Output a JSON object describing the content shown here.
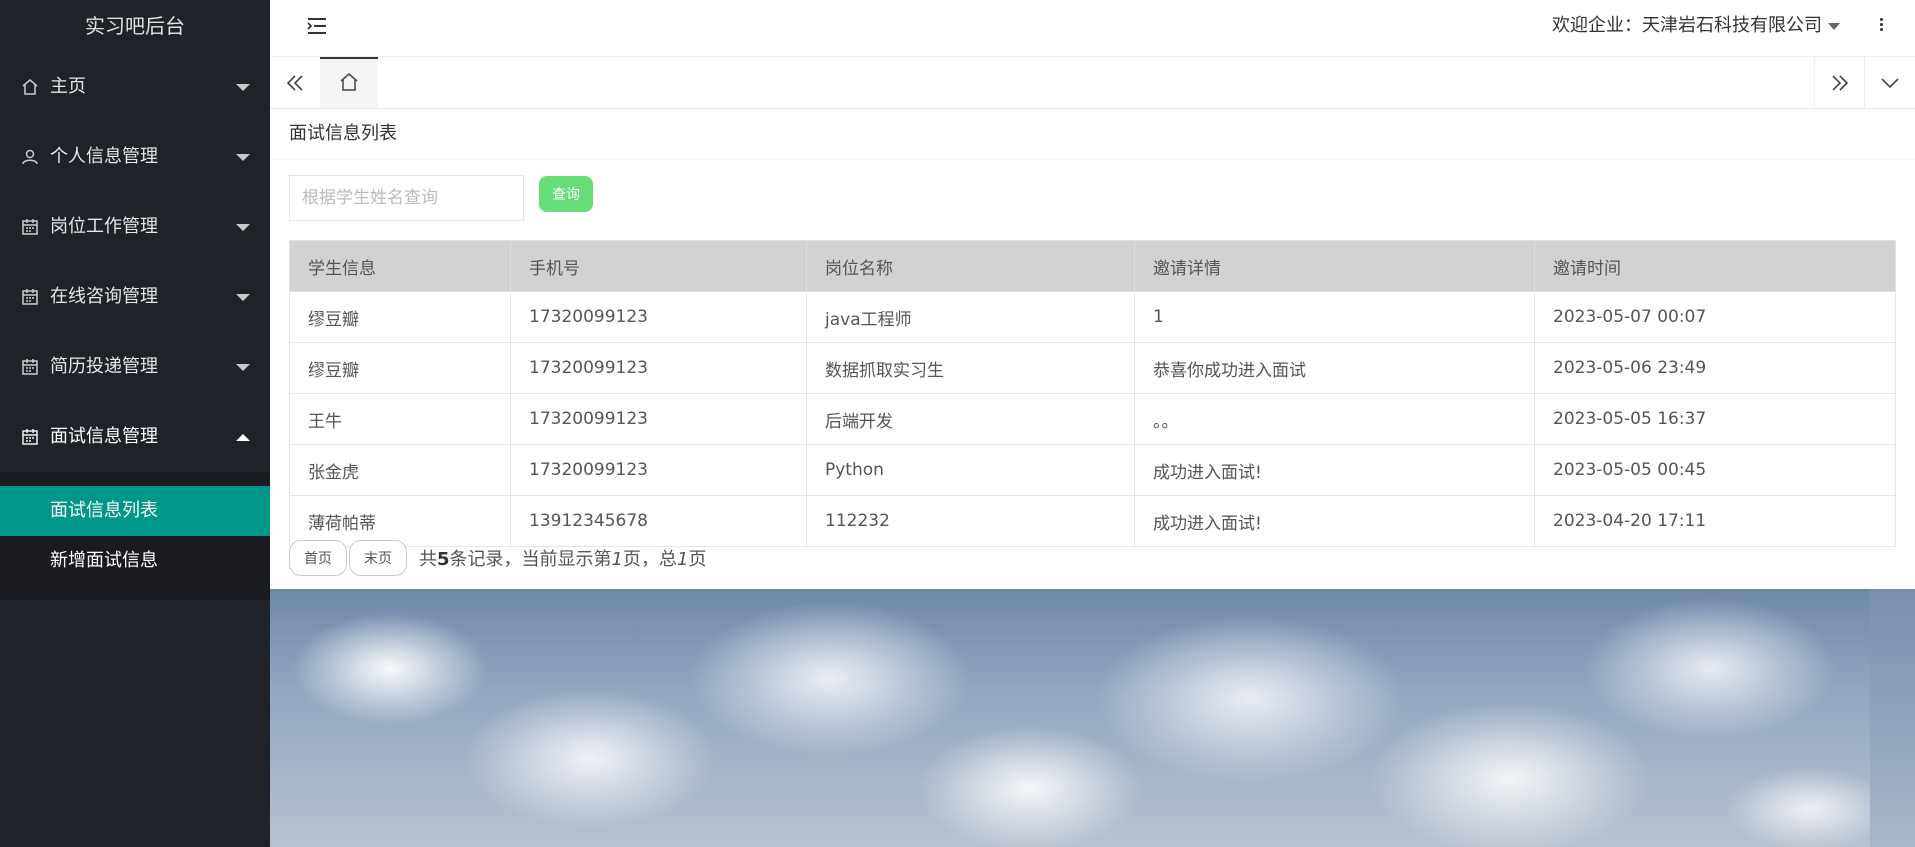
{
  "sidebar": {
    "brand": "实习吧后台",
    "items": [
      {
        "label": "主页",
        "icon": "home-icon",
        "expanded": false
      },
      {
        "label": "个人信息管理",
        "icon": "user-icon",
        "expanded": false
      },
      {
        "label": "岗位工作管理",
        "icon": "calendar-icon",
        "expanded": false
      },
      {
        "label": "在线咨询管理",
        "icon": "calendar-icon",
        "expanded": false
      },
      {
        "label": "简历投递管理",
        "icon": "calendar-icon",
        "expanded": false
      },
      {
        "label": "面试信息管理",
        "icon": "calendar-icon",
        "expanded": true
      }
    ],
    "subitems": [
      {
        "label": "面试信息列表",
        "active": true
      },
      {
        "label": "新增面试信息",
        "active": false
      }
    ]
  },
  "header": {
    "welcome": "欢迎企业：天津岩石科技有限公司"
  },
  "page": {
    "title": "面试信息列表",
    "search_placeholder": "根据学生姓名查询",
    "search_value": "",
    "search_button": "查询"
  },
  "table": {
    "columns": [
      "学生信息",
      "手机号",
      "岗位名称",
      "邀请详情",
      "邀请时间"
    ],
    "rows": [
      [
        "缪豆瓣",
        "17320099123",
        "java工程师",
        "1",
        "2023-05-07 00:07"
      ],
      [
        "缪豆瓣",
        "17320099123",
        "数据抓取实习生",
        "恭喜你成功进入面试",
        "2023-05-06 23:49"
      ],
      [
        "王牛",
        "17320099123",
        "后端开发",
        "。。",
        "2023-05-05 16:37"
      ],
      [
        "张金虎",
        "17320099123",
        "Python",
        "成功进入面试!",
        "2023-05-05 00:45"
      ],
      [
        "薄荷帕蒂",
        "13912345678",
        "112232",
        "成功进入面试!",
        "2023-04-20 17:11"
      ]
    ]
  },
  "pager": {
    "first": "首页",
    "last": "末页",
    "text_prefix": "共",
    "total_records": "5",
    "text_mid": "条记录，当前显示第",
    "current_page": "1",
    "text_mid2": "页，总",
    "total_pages": "1",
    "text_suffix": "页"
  },
  "colors": {
    "sidebar_bg": "#20222a",
    "active_item": "#009688",
    "search_button": "#66dd77",
    "table_header": "#d2d2d2"
  }
}
